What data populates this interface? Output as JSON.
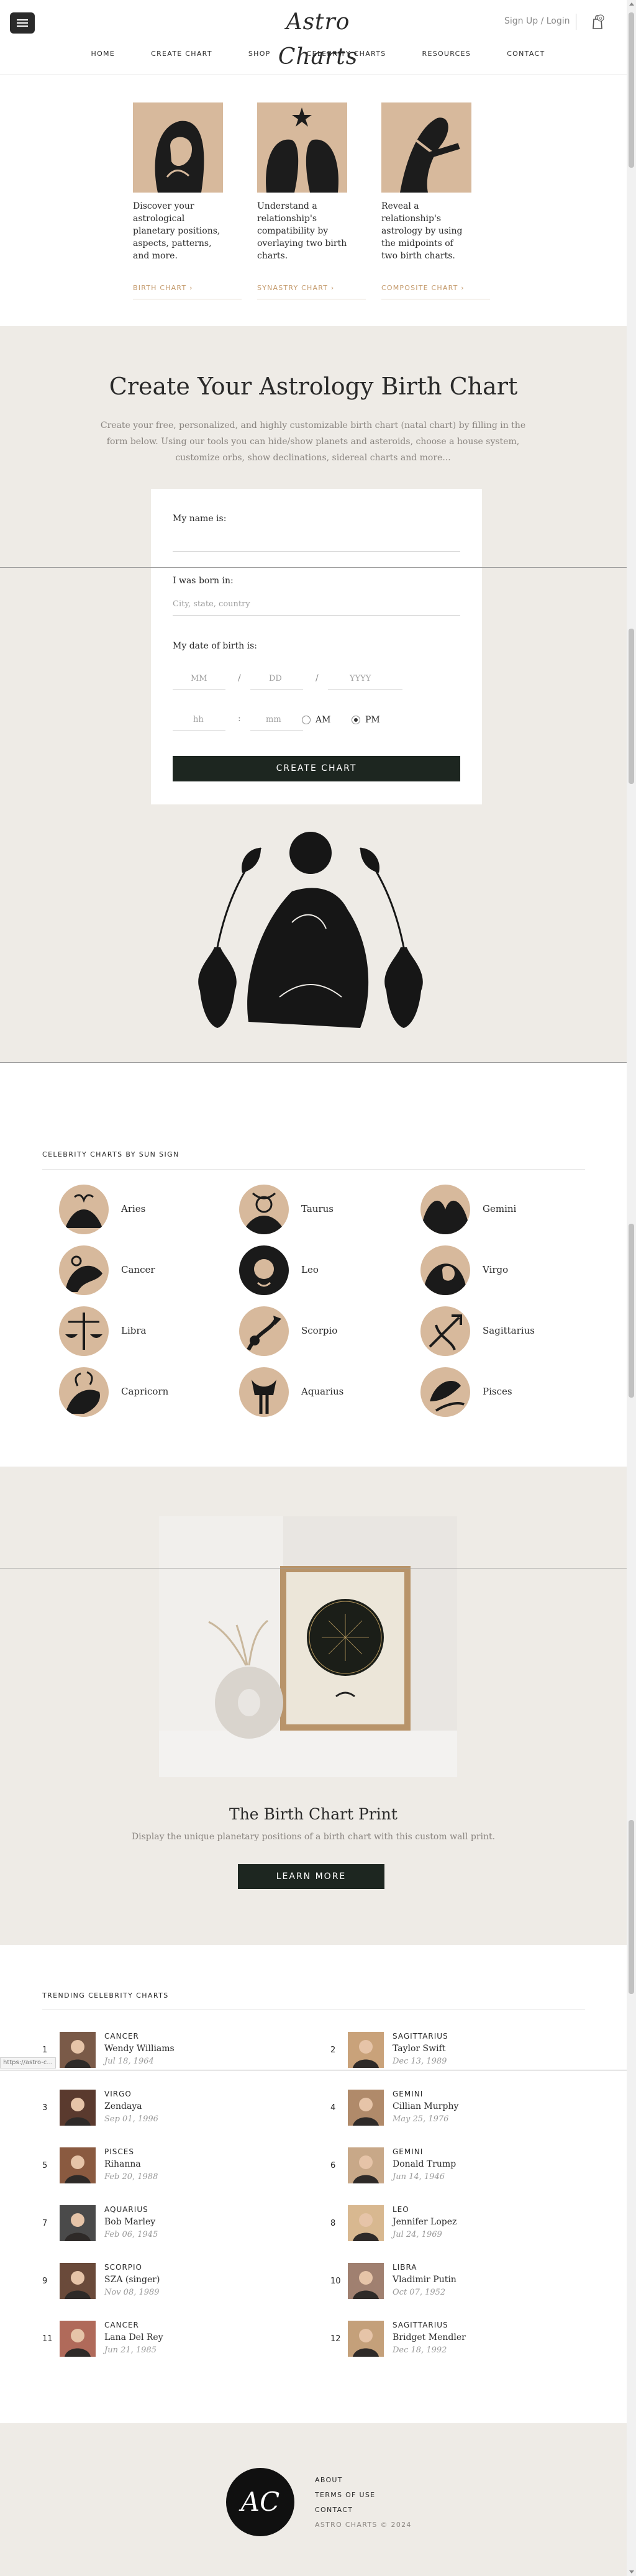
{
  "header": {
    "logo": "Astro Charts",
    "account_link": "Sign Up / Login",
    "nav": [
      "HOME",
      "CREATE CHART",
      "SHOP",
      "CELEBRITY CHARTS",
      "RESOURCES",
      "CONTACT"
    ]
  },
  "features": [
    {
      "text": "Discover your astrological planetary positions, aspects, patterns, and more.",
      "link": "BIRTH CHART"
    },
    {
      "text": "Understand a relationship's compatibility by overlaying two birth charts.",
      "link": "SYNASTRY CHART"
    },
    {
      "text": "Reveal a relationship's astrology by using the midpoints of two birth charts.",
      "link": "COMPOSITE CHART"
    }
  ],
  "create": {
    "title": "Create Your Astrology Birth Chart",
    "intro": "Create your free, personalized, and highly customizable birth chart (natal chart) by filling in the form below. Using our tools you can hide/show planets and asteroids, choose a house system, customize orbs, show declinations, sidereal charts and more...",
    "name_label": "My name is:",
    "born_label": "I was born in:",
    "city_placeholder": "City, state, country",
    "dob_label": "My date of birth is:",
    "mm": "MM",
    "dd": "DD",
    "yyyy": "YYYY",
    "hh": "hh",
    "min": "mm",
    "am": "AM",
    "pm": "PM",
    "button": "CREATE CHART"
  },
  "signs": {
    "title": "CELEBRITY CHARTS BY SUN SIGN",
    "items": [
      "Aries",
      "Taurus",
      "Gemini",
      "Cancer",
      "Leo",
      "Virgo",
      "Libra",
      "Scorpio",
      "Sagittarius",
      "Capricorn",
      "Aquarius",
      "Pisces"
    ]
  },
  "print": {
    "title": "The Birth Chart Print",
    "desc": "Display the unique planetary positions of a birth chart with this custom wall print.",
    "button": "LEARN MORE"
  },
  "trending": {
    "title": "TRENDING CELEBRITY CHARTS",
    "items": [
      {
        "num": "1",
        "sign": "CANCER",
        "name": "Wendy Williams",
        "date": "Jul 18, 1964"
      },
      {
        "num": "2",
        "sign": "SAGITTARIUS",
        "name": "Taylor Swift",
        "date": "Dec 13, 1989"
      },
      {
        "num": "3",
        "sign": "VIRGO",
        "name": "Zendaya",
        "date": "Sep 01, 1996"
      },
      {
        "num": "4",
        "sign": "GEMINI",
        "name": "Cillian Murphy",
        "date": "May 25, 1976"
      },
      {
        "num": "5",
        "sign": "PISCES",
        "name": "Rihanna",
        "date": "Feb 20, 1988"
      },
      {
        "num": "6",
        "sign": "GEMINI",
        "name": "Donald Trump",
        "date": "Jun 14, 1946"
      },
      {
        "num": "7",
        "sign": "AQUARIUS",
        "name": "Bob Marley",
        "date": "Feb 06, 1945"
      },
      {
        "num": "8",
        "sign": "LEO",
        "name": "Jennifer Lopez",
        "date": "Jul 24, 1969"
      },
      {
        "num": "9",
        "sign": "SCORPIO",
        "name": "SZA (singer)",
        "date": "Nov 08, 1989"
      },
      {
        "num": "10",
        "sign": "LIBRA",
        "name": "Vladimir Putin",
        "date": "Oct 07, 1952"
      },
      {
        "num": "11",
        "sign": "CANCER",
        "name": "Lana Del Rey",
        "date": "Jun 21, 1985"
      },
      {
        "num": "12",
        "sign": "SAGITTARIUS",
        "name": "Bridget Mendler",
        "date": "Dec 18, 1992"
      }
    ],
    "status_url": "https://astro-c..."
  },
  "footer": {
    "logo": "AC",
    "links": [
      "ABOUT",
      "TERMS OF USE",
      "CONTACT"
    ],
    "copyright": "ASTRO CHARTS © 2024"
  },
  "colors": {
    "accent": "#c49a6c",
    "tan": "#d7b99c",
    "dark_button": "#1d2620",
    "section_bg": "#eeebe6"
  }
}
